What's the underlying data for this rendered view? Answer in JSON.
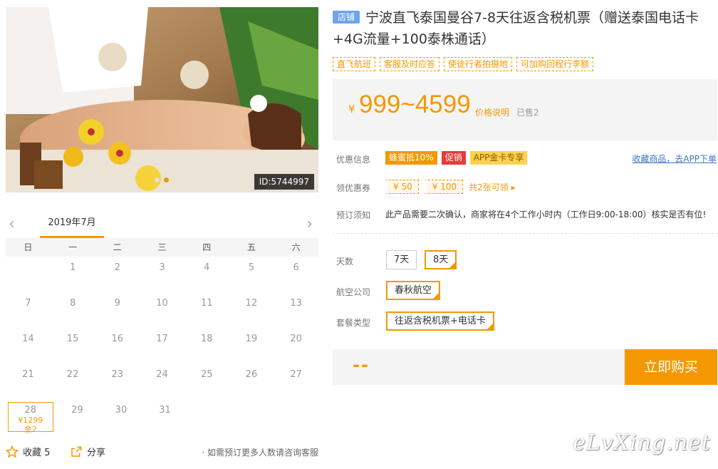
{
  "product": {
    "shop_badge": "店铺",
    "title": "宁波直飞泰国曼谷7-8天往返含税机票（赠送泰国电话卡+4G流量+100泰株通话）",
    "image_id": "ID:5744997",
    "tags": [
      "直飞航班",
      "客服及时应答",
      "使徒行者拍摄地",
      "可加购回程行李额"
    ]
  },
  "price": {
    "symbol": "¥",
    "range": "999~4599",
    "note": "价格说明",
    "sold": "已售2"
  },
  "promo": {
    "label": "优惠信息",
    "badges": [
      {
        "text": "蜂蜜抵10%",
        "bg": "#f39800",
        "fg": "#ffffff"
      },
      {
        "text": "促销",
        "bg": "#e83a3a",
        "fg": "#ffffff"
      },
      {
        "text": "APP金卡专享",
        "bg": "#ffd24d",
        "fg": "#8a5a00"
      }
    ],
    "fav_link": "收藏商品，去APP下单"
  },
  "coupons": {
    "label": "领优惠券",
    "items": [
      "¥ 50",
      "¥ 100"
    ],
    "link": "共2张可领 ▸"
  },
  "notice": {
    "label": "预订须知",
    "text": "此产品需要二次确认，商家将在4个工作小时内（工作日9:00-18:00）核实是否有位!"
  },
  "options": {
    "days_label": "天数",
    "days": [
      "7天",
      "8天"
    ],
    "airline_label": "航空公司",
    "airline": "春秋航空",
    "package_label": "套餐类型",
    "package": "往返含税机票+电话卡"
  },
  "buy": {
    "qty": "--",
    "button": "立即购买"
  },
  "calendar": {
    "month": "2019年7月",
    "prev": "‹",
    "next": "›",
    "weekdays": [
      "日",
      "一",
      "二",
      "三",
      "四",
      "五",
      "六"
    ],
    "rows": [
      [
        "",
        "1",
        "2",
        "3",
        "4",
        "5",
        "6"
      ],
      [
        "7",
        "8",
        "9",
        "10",
        "11",
        "12",
        "13"
      ],
      [
        "14",
        "15",
        "16",
        "17",
        "18",
        "19",
        "20"
      ],
      [
        "21",
        "22",
        "23",
        "24",
        "25",
        "26",
        "27"
      ],
      [
        "28",
        "29",
        "30",
        "31",
        "",
        "",
        ""
      ]
    ],
    "selected": {
      "day": "28",
      "price": "¥1299",
      "stock": "余2"
    }
  },
  "footer": {
    "fav": "收藏 5",
    "share": "分享",
    "hint": "· 如需预订更多人数请咨询客服"
  },
  "watermark": "eLvXing.net",
  "colors": {
    "accent": "#f39800",
    "link": "#3a77c7",
    "shop_badge": "#6ea6e8"
  }
}
